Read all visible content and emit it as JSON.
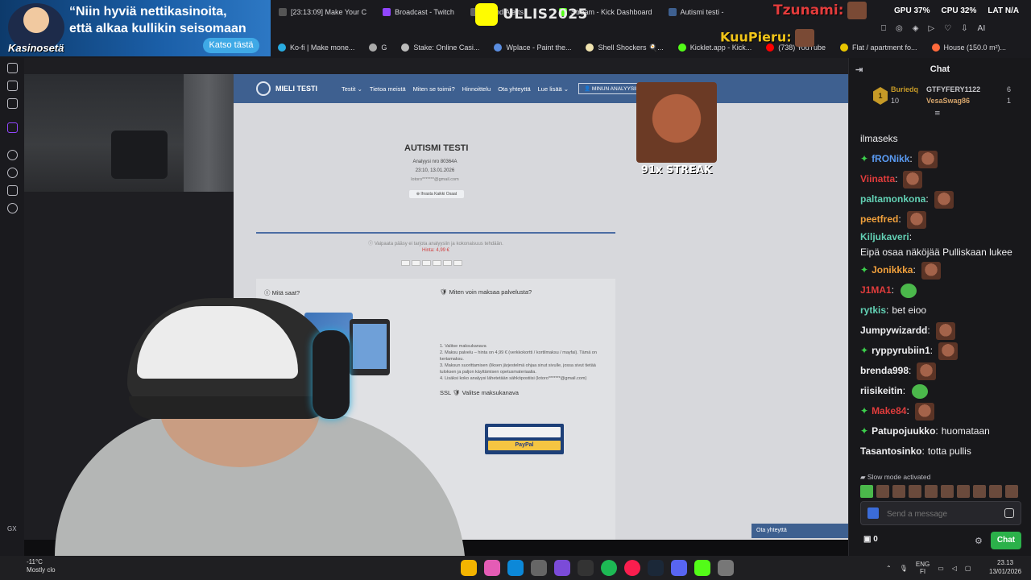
{
  "ad": {
    "text_line1": "“Niin hyviä nettikasinoita,",
    "text_line2": "että alkaa kullikin seisomaan",
    "logo": "Kasinosetä",
    "cta": "Katso tästä"
  },
  "browser": {
    "tabs": [
      {
        "label": "[23:13:09] Make Your C"
      },
      {
        "label": "Broadcast - Twitch"
      },
      {
        "label": "Sound Alerts"
      },
      {
        "label": "Stream - Kick Dashboard"
      },
      {
        "label": "Autismi testi - "
      }
    ],
    "bookmarks": [
      {
        "label": "Ko-fi | Make mone..."
      },
      {
        "label": "G"
      },
      {
        "label": "Stake: Online Casi..."
      },
      {
        "label": "Wplace - Paint the..."
      },
      {
        "label": "Shell Shockers 🍳..."
      },
      {
        "label": "Kicklet.app - Kick..."
      },
      {
        "label": "(738) YouTube"
      },
      {
        "label": "Flat / apartment fo..."
      },
      {
        "label": "House (150.0 m²)..."
      }
    ],
    "stats": {
      "gpu": "GPU 37%",
      "cpu": "CPU 32%",
      "lat": "LAT N/A",
      "left": "A"
    },
    "ai_label": "AI"
  },
  "overlays": {
    "snap_name": "ULLIS2025",
    "kuu": "KuuPieru:",
    "tsu": "Tzunami:",
    "streak": "91x STREAK"
  },
  "site": {
    "brand": "MIELI TESTI",
    "menu": [
      "Testit ⌄",
      "Tietoa meistä",
      "Miten se toimii?",
      "Hinnoittelu",
      "Ota yhteyttä",
      "Lue lisää ⌄"
    ],
    "button": "👤 MINUN ANALYYSINI",
    "title": "AUTISMI TESTI",
    "analysis_no": "Analyysi nro 80364A",
    "datetime": "23:10, 13.01.2026",
    "email": "lotoro*******@gmail.com",
    "pill": "⊕ Ihrasta Kaikki Osaat",
    "note": "Ⓘ Vaipaata pääsy ei tarjota analyysiin ja kokonaisuus tehdään.",
    "price": "Hinta: 4,99 €",
    "what_get": "Ⓘ Mitä saat?",
    "how_pay": "🛡 Miten voin maksaa palvelusta?",
    "steps": "1. Valitse maksukanava\n2. Maksu palvelu – hinta on 4,99 € (verkkokortti / kortilmaksu / mayfai). Tämä on kertamaksu.\n3. Maksun suorittamisen (liksen järjestelmä ohjaa sinut sivulle, jossa sivut tietää tuloksen ja paljon käyttämisen opetusmateriaalia.\n4. Lisäksi koko analyysi lähetetään sähköpostiisi (lotoro*******@gmail.com)",
    "choose_pay": "SSL 🛡 Valitse maksukanava",
    "paypal": "PayPal",
    "contact": "Ota yhteyttä"
  },
  "chat": {
    "title": "Chat",
    "leaderboard": {
      "first_name": "Buriedq",
      "first_count": "10",
      "second_name": "GTFYFERY1122",
      "second_count": "6",
      "third_name": "VesaSwag86",
      "third_count": "1"
    },
    "messages": [
      {
        "user": "",
        "text": "ilmaseks",
        "color": "#efeff1",
        "gem": false,
        "emote": ""
      },
      {
        "user": "fRONikk",
        "text": "",
        "color": "#5a9bf3",
        "gem": true,
        "emote": "face"
      },
      {
        "user": "Viinatta",
        "text": "",
        "color": "#e03c3c",
        "gem": false,
        "emote": "face"
      },
      {
        "user": "paltamonkona",
        "text": "",
        "color": "#62d0b4",
        "gem": false,
        "emote": "face"
      },
      {
        "user": "peetfred",
        "text": "",
        "color": "#f0a03c",
        "gem": false,
        "emote": "face"
      },
      {
        "user": "Kiljukaveri",
        "text": "Eipä osaa näköjää Pulliskaan lukee",
        "color": "#62d0b4",
        "gem": false,
        "emote": ""
      },
      {
        "user": "Jonikkka",
        "text": "",
        "color": "#f0a03c",
        "gem": true,
        "emote": "face"
      },
      {
        "user": "J1MA1",
        "text": "",
        "color": "#e03c3c",
        "gem": false,
        "emote": "pepe"
      },
      {
        "user": "rytkis",
        "text": "bet eioo",
        "color": "#62d0b4",
        "gem": false,
        "emote": ""
      },
      {
        "user": "Jumpywizardd",
        "text": "",
        "color": "#efeff1",
        "gem": false,
        "emote": "face"
      },
      {
        "user": "ryppyrubiin1",
        "text": "",
        "color": "#efeff1",
        "gem": true,
        "emote": "face"
      },
      {
        "user": "brenda998",
        "text": "",
        "color": "#efeff1",
        "gem": false,
        "emote": "face"
      },
      {
        "user": "riisikeitin",
        "text": "",
        "color": "#efeff1",
        "gem": false,
        "emote": "pepe"
      },
      {
        "user": "Make84",
        "text": "",
        "color": "#e03c3c",
        "gem": true,
        "emote": "face"
      },
      {
        "user": "Patupojuukko",
        "text": "huomataan",
        "color": "#efeff1",
        "gem": true,
        "emote": ""
      },
      {
        "user": "Tasantosinko",
        "text": "totta pullis",
        "color": "#efeff1",
        "gem": false,
        "emote": ""
      }
    ],
    "slow_mode": "Slow mode activated",
    "input_placeholder": "Send a message",
    "points": "0",
    "send_button": "Chat"
  },
  "taskbar": {
    "temp": "-11°C",
    "weather": "Mostly clo",
    "lang1": "ENG",
    "lang2": "FI",
    "time": "23.13",
    "date": "13/01/2026",
    "gx": "GX"
  }
}
